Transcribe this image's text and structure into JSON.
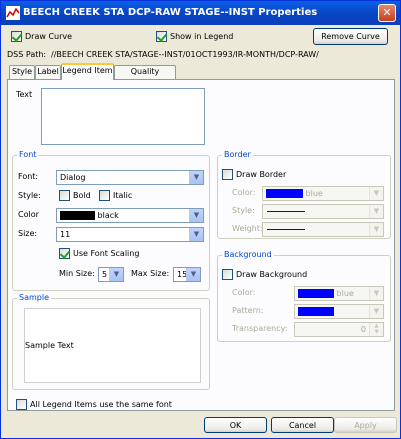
{
  "window": {
    "title": "BEECH CREEK STA DCP-RAW STAGE--INST Properties",
    "close_label": "✕"
  },
  "top": {
    "draw_curve_label": "Draw Curve",
    "show_in_legend_label": "Show in Legend",
    "remove_curve_label": "Remove Curve",
    "dss_path_label": "DSS Path:",
    "dss_path_value": "//BEECH CREEK STA/STAGE--INST/01OCT1993/IR-MONTH/DCP-RAW/"
  },
  "tabs": [
    {
      "label": "Style"
    },
    {
      "label": "Label"
    },
    {
      "label": "Legend Item"
    },
    {
      "label": "Quality Symbols"
    }
  ],
  "legend_item": {
    "text_label": "Text",
    "text_value": ""
  },
  "font": {
    "group_label": "Font",
    "font_label": "Font:",
    "font_value": "Dialog",
    "style_label": "Style:",
    "bold_label": "Bold",
    "italic_label": "Italic",
    "color_label": "Color",
    "color_value": "black",
    "color_hex": "#000000",
    "size_label": "Size:",
    "size_value": "11",
    "use_scaling_label": "Use Font Scaling",
    "min_size_label": "Min Size:",
    "min_size_value": "5",
    "max_size_label": "Max Size:",
    "max_size_value": "15"
  },
  "sample": {
    "group_label": "Sample",
    "text": "Sample Text"
  },
  "border": {
    "group_label": "Border",
    "draw_border_label": "Draw Border",
    "color_label": "Color:",
    "color_value": "blue",
    "color_hex": "#0000ff",
    "style_label": "Style:",
    "weight_label": "Weight:"
  },
  "background": {
    "group_label": "Background",
    "draw_background_label": "Draw Background",
    "color_label": "Color:",
    "color_value": "blue",
    "color_hex": "#0000ff",
    "pattern_label": "Pattern:",
    "transparency_label": "Transparency:",
    "transparency_value": "0"
  },
  "footer": {
    "same_font_label": "All Legend Items use the same font",
    "ok_label": "OK",
    "cancel_label": "Cancel",
    "apply_label": "Apply"
  }
}
